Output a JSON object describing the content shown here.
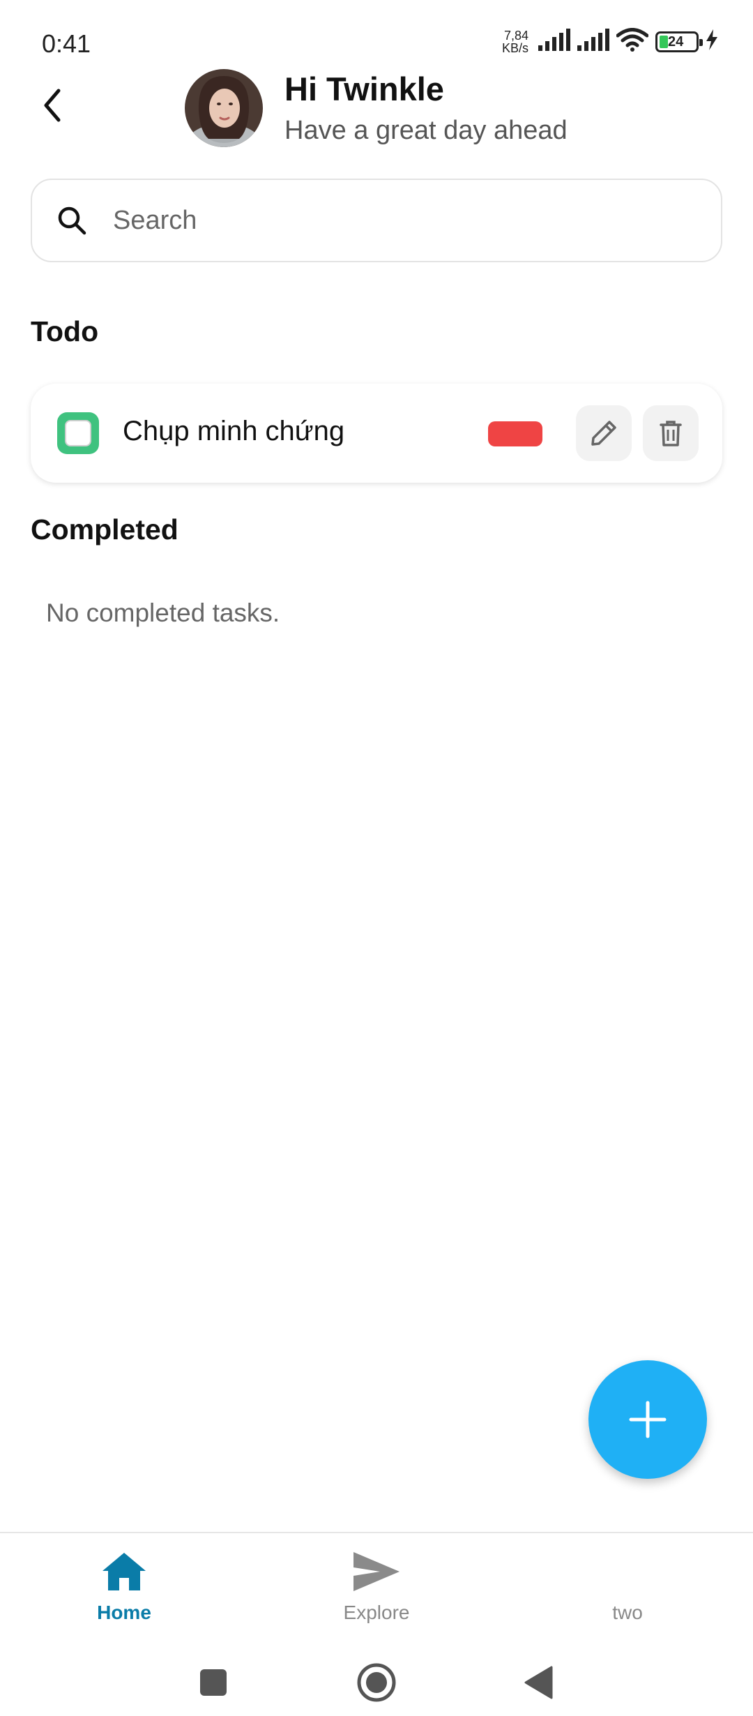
{
  "status_bar": {
    "time": "0:41",
    "net_speed_value": "7,84",
    "net_speed_unit": "KB/s",
    "battery": "24"
  },
  "header": {
    "title": "Hi Twinkle",
    "subtitle": "Have a great day ahead"
  },
  "search": {
    "placeholder": "Search",
    "value": ""
  },
  "sections": {
    "todo_title": "Todo",
    "completed_title": "Completed"
  },
  "todo_items": [
    {
      "label": "Chụp minh chứng",
      "checked": false,
      "priority_color": "#ef4444"
    }
  ],
  "completed": {
    "empty_message": "No completed tasks."
  },
  "nav": {
    "items": [
      {
        "label": "Home",
        "icon": "home-icon",
        "active": true
      },
      {
        "label": "Explore",
        "icon": "send-icon",
        "active": false
      },
      {
        "label": "two",
        "icon": "",
        "active": false
      }
    ]
  },
  "colors": {
    "accent": "#1fb0f5",
    "nav_active": "#0a7ca8",
    "checkbox": "#3fc27f",
    "priority": "#ef4444"
  }
}
